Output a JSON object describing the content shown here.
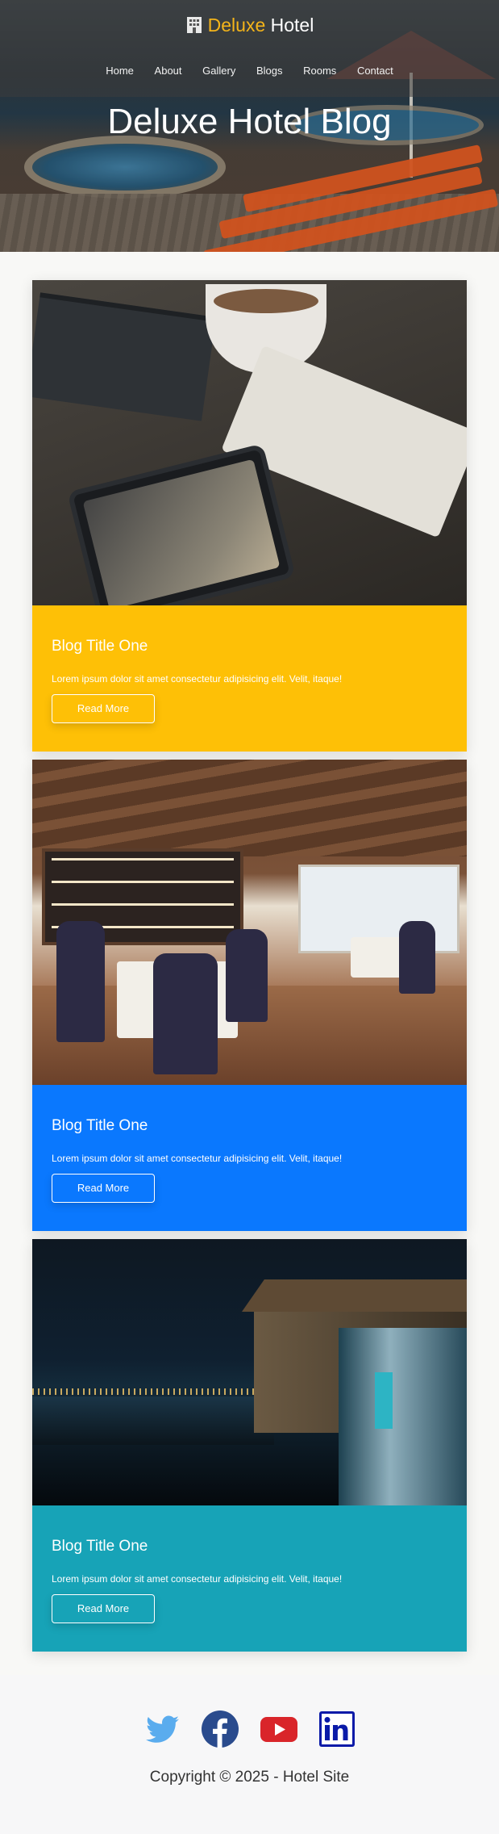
{
  "brand": {
    "first": "Deluxe",
    "second": "Hotel",
    "icon": "hotel-building-icon",
    "accent_color": "#f4b41a"
  },
  "nav": {
    "items": [
      "Home",
      "About",
      "Gallery",
      "Blogs",
      "Rooms",
      "Contact"
    ]
  },
  "hero": {
    "title": "Deluxe Hotel Blog"
  },
  "posts": [
    {
      "title": "Blog Title One",
      "text": "Lorem ipsum dolor sit amet consectetur adipisicing elit. Velit, itaque!",
      "button": "Read More",
      "color": "#fec006"
    },
    {
      "title": "Blog Title One",
      "text": "Lorem ipsum dolor sit amet consectetur adipisicing elit. Velit, itaque!",
      "button": "Read More",
      "color": "#0a78fe"
    },
    {
      "title": "Blog Title One",
      "text": "Lorem ipsum dolor sit amet consectetur adipisicing elit. Velit, itaque!",
      "button": "Read More",
      "color": "#17a3b7"
    }
  ],
  "footer": {
    "socials": [
      "twitter-icon",
      "facebook-icon",
      "youtube-icon",
      "linkedin-icon"
    ],
    "copyright": "Copyright © 2025 - Hotel Site"
  }
}
